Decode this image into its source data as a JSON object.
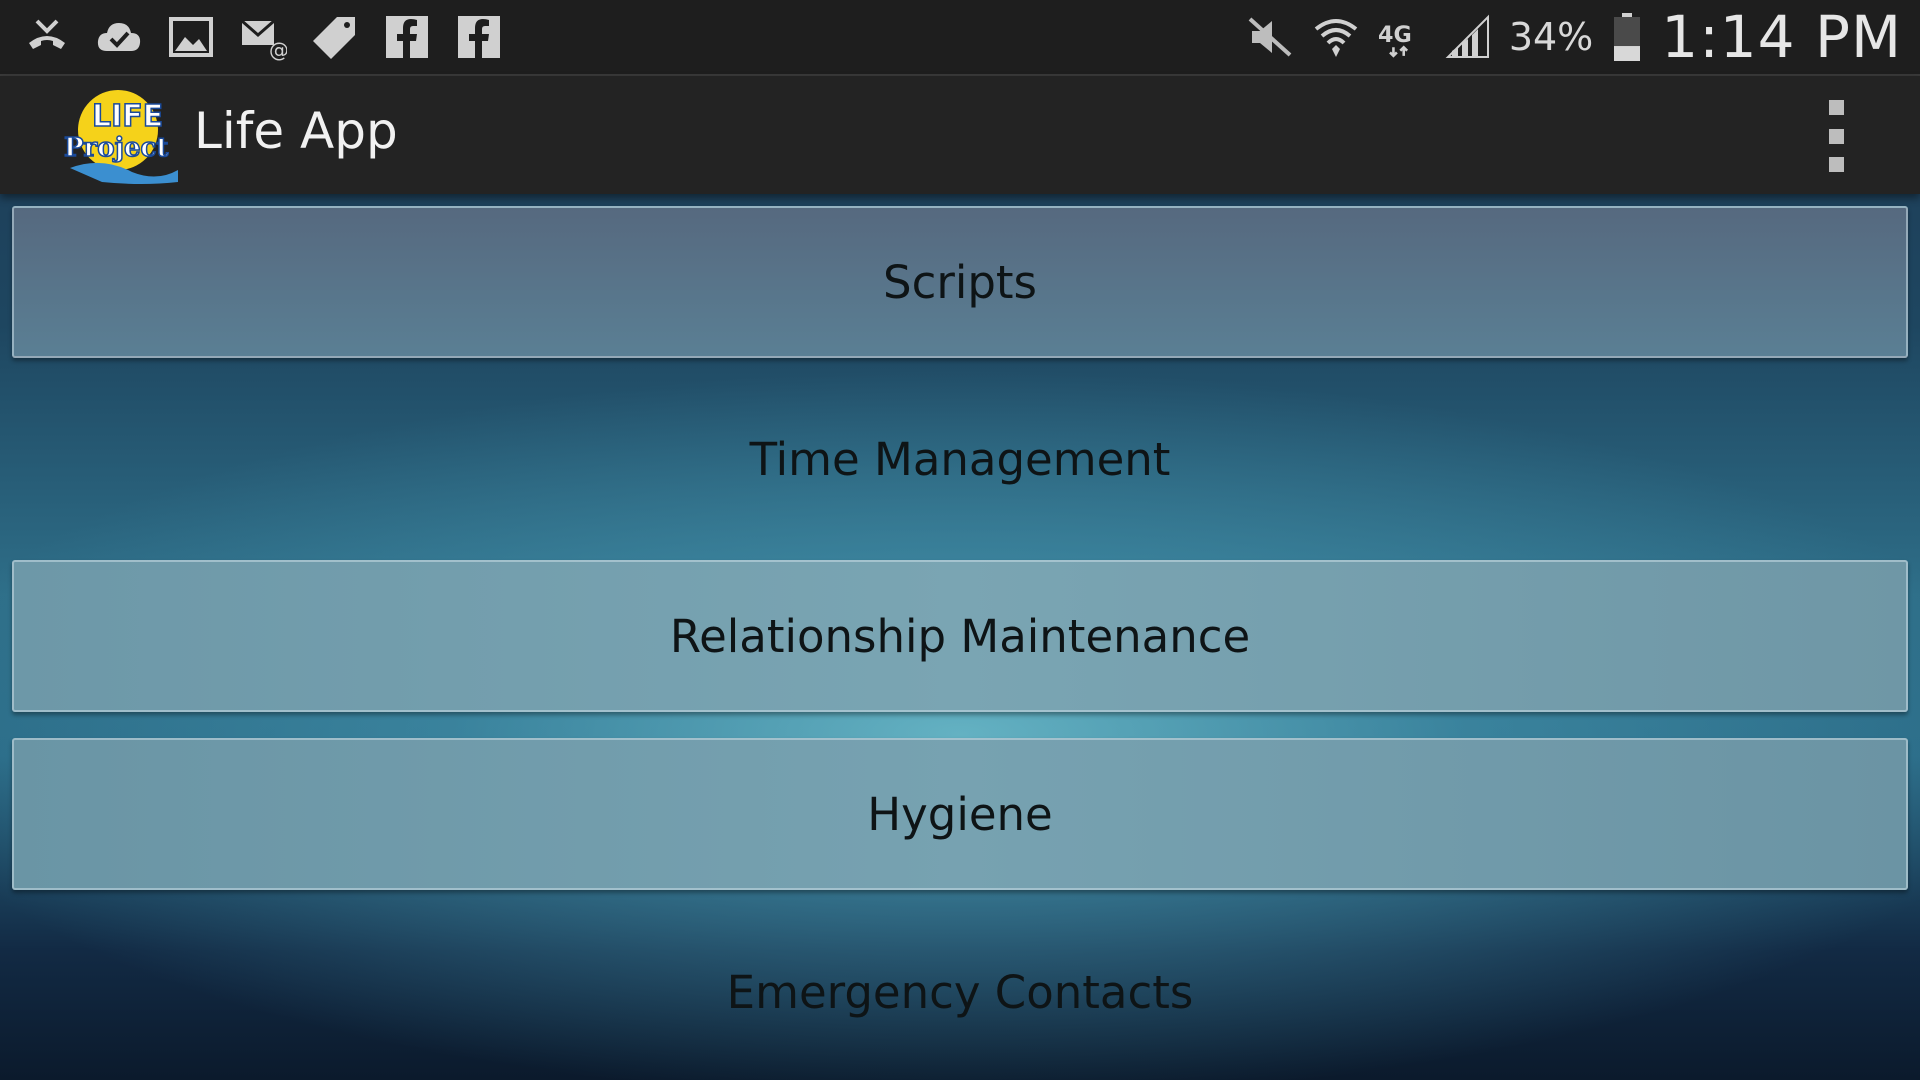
{
  "status_bar": {
    "left_icons": [
      "missed-call-icon",
      "cloud-check-icon",
      "gallery-icon",
      "email-icon",
      "tag-icon",
      "facebook-icon",
      "facebook-icon"
    ],
    "right_icons": [
      "mute-icon",
      "wifi-icon",
      "4g-lte-icon",
      "signal-icon",
      "battery-icon"
    ],
    "network_label": "4G",
    "battery": "34%",
    "battery_level": 0.34,
    "time": "1:14 PM"
  },
  "action_bar": {
    "logo_text_top": "LIFE",
    "logo_text_bottom": "Project",
    "title": "Life App",
    "overflow_icon": "overflow-menu-icon"
  },
  "menu": {
    "items": [
      {
        "label": "Scripts"
      },
      {
        "label": "Time Management"
      },
      {
        "label": "Relationship Maintenance"
      },
      {
        "label": "Hygiene"
      },
      {
        "label": "Emergency Contacts"
      }
    ]
  },
  "colors": {
    "status_bar_bg": "#1e1e1e",
    "action_bar_bg": "#232323",
    "logo_sun": "#f5d21a",
    "logo_water": "#3b8fd0",
    "menu_text": "#0e1416"
  }
}
